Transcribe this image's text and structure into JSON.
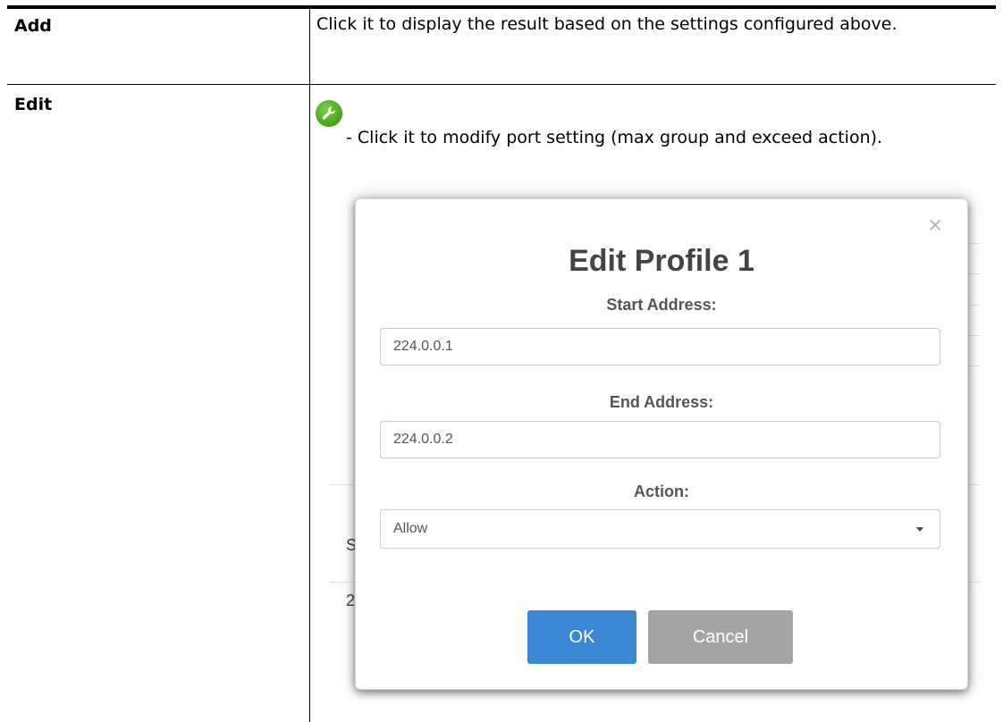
{
  "rows": [
    {
      "term": "Add",
      "description": "Click it to display the result based on the settings configured above."
    },
    {
      "term": "Edit",
      "description": "- Click it to modify port setting (max group and exceed action).",
      "icon": "wrench-icon"
    }
  ],
  "dialog": {
    "title": "Edit Profile 1",
    "close_symbol": "×",
    "start_label": "Start Address:",
    "start_value": "224.0.0.1",
    "end_label": "End Address:",
    "end_value": "224.0.0.2",
    "action_label": "Action:",
    "action_value": "Allow",
    "ok_label": "OK",
    "cancel_label": "Cancel"
  },
  "background": {
    "fragment_s": "S",
    "fragment_2": "2"
  },
  "colors": {
    "icon_green": "#4ba820",
    "ok_blue": "#3a87d6",
    "cancel_gray": "#a4a4a4"
  }
}
